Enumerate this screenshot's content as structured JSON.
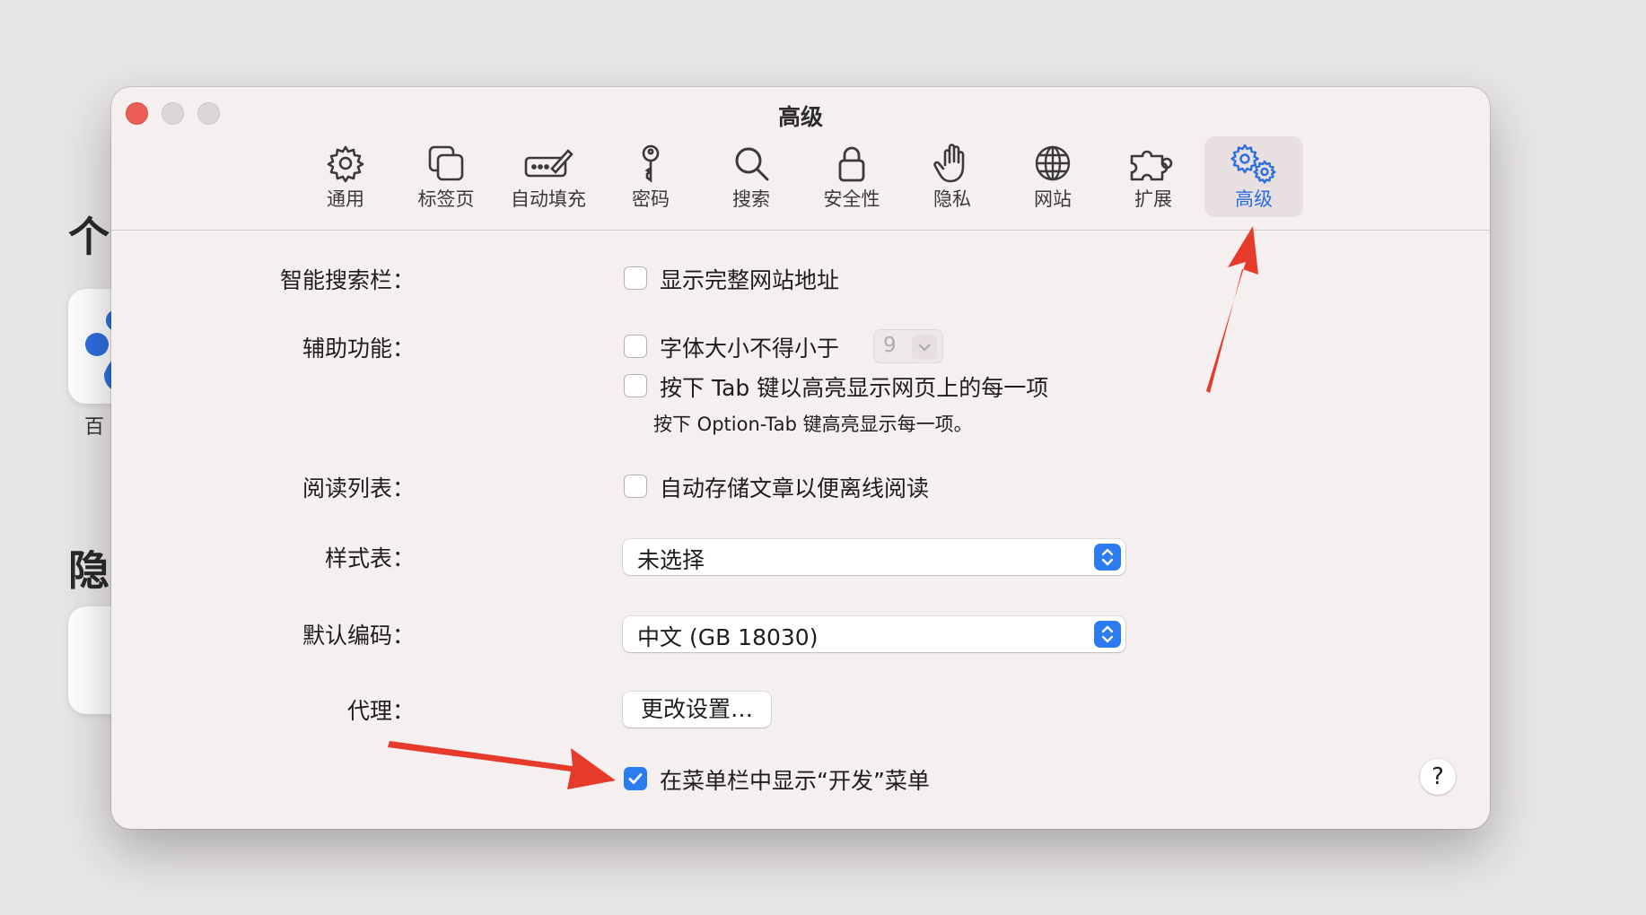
{
  "background": {
    "heading_top": "个",
    "tile_label": "百",
    "heading_bottom": "隐"
  },
  "window": {
    "title": "高级",
    "toolbar": [
      {
        "label": "通用",
        "icon": "gear-icon"
      },
      {
        "label": "标签页",
        "icon": "tabs-icon"
      },
      {
        "label": "自动填充",
        "icon": "autofill-pen-icon"
      },
      {
        "label": "密码",
        "icon": "key-icon"
      },
      {
        "label": "搜索",
        "icon": "search-icon"
      },
      {
        "label": "安全性",
        "icon": "lock-icon"
      },
      {
        "label": "隐私",
        "icon": "hand-icon"
      },
      {
        "label": "网站",
        "icon": "globe-icon"
      },
      {
        "label": "扩展",
        "icon": "puzzle-icon"
      },
      {
        "label": "高级",
        "icon": "gears-icon",
        "active": true
      }
    ],
    "smart_search": {
      "label": "智能搜索栏：",
      "option": "显示完整网站地址",
      "checked": false
    },
    "accessibility": {
      "label": "辅助功能：",
      "option_font": "字体大小不得小于",
      "font_size_value": "9",
      "option_tab": "按下 Tab 键以高亮显示网页上的每一项",
      "note": "按下 Option-Tab 键高亮显示每一项。"
    },
    "reading_list": {
      "label": "阅读列表：",
      "option": "自动存储文章以便离线阅读"
    },
    "style_sheet": {
      "label": "样式表：",
      "value": "未选择"
    },
    "encoding": {
      "label": "默认编码：",
      "value": "中文 (GB 18030)"
    },
    "proxy": {
      "label": "代理：",
      "button": "更改设置…"
    },
    "develop_menu": {
      "option": "在菜单栏中显示“开发”菜单",
      "checked": true
    },
    "help": "?"
  },
  "colors": {
    "accent": "#2b7cf0",
    "annotation_arrow": "#e63a2a",
    "close_button": "#ed5e58"
  }
}
